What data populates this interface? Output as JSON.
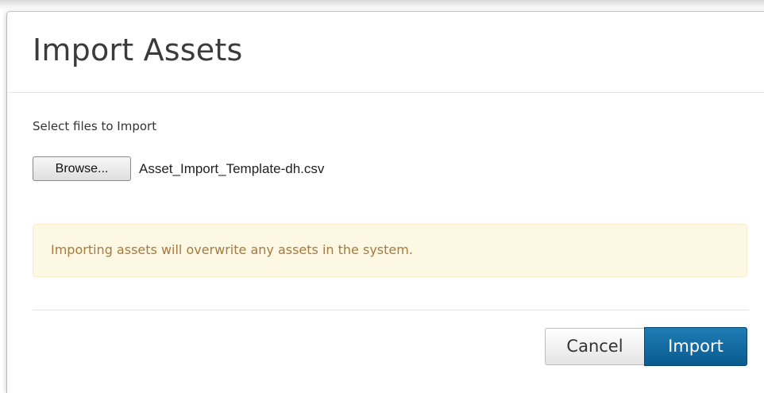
{
  "dialog": {
    "title": "Import Assets",
    "files_label": "Select files to Import",
    "browse_label": "Browse...",
    "selected_file": "Asset_Import_Template-dh.csv",
    "warning": "Importing assets will overwrite any assets in the system.",
    "cancel_label": "Cancel",
    "import_label": "Import"
  },
  "colors": {
    "warning_background": "#fcf8e3",
    "warning_text": "#a8793e",
    "primary_button": "#0a5b8f"
  }
}
